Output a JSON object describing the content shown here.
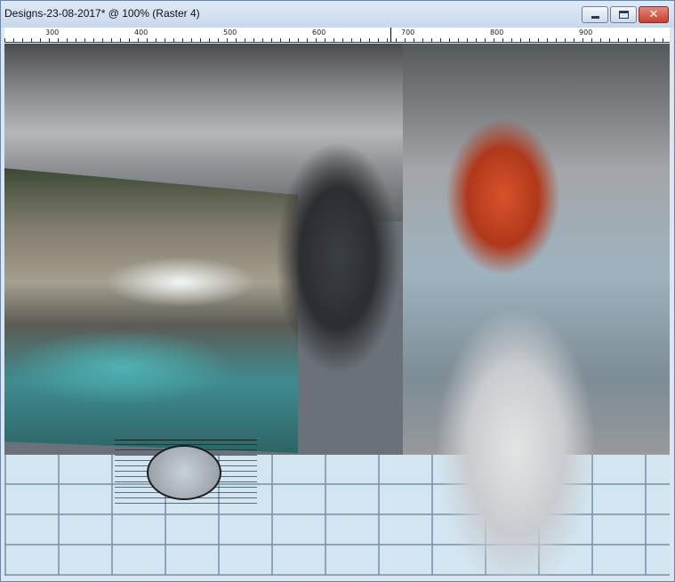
{
  "window": {
    "title": "Designs-23-08-2017* @ 100% (Raster 4)",
    "minimize_label": "minimize",
    "maximize_label": "maximize",
    "close_glyph": "✕"
  },
  "ruler": {
    "labels": [
      "300",
      "400",
      "500",
      "600",
      "700",
      "800",
      "900"
    ]
  },
  "canvas": {
    "watermark_logo": "claudia-logo"
  },
  "colors": {
    "titlebar": "#c8d8ec",
    "close": "#c6402f",
    "floor": "#d3e5f1"
  }
}
